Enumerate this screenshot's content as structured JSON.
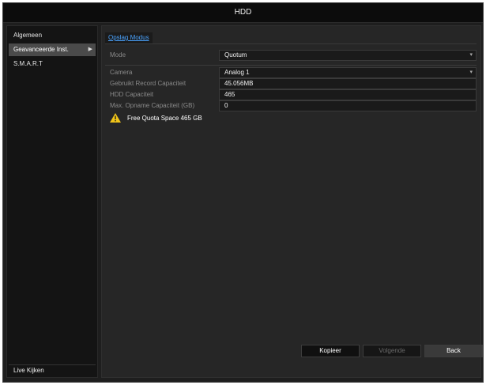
{
  "window": {
    "title": "HDD"
  },
  "sidebar": {
    "items": [
      {
        "label": "Algemeen"
      },
      {
        "label": "Geavanceerde Inst.",
        "active": true
      },
      {
        "label": "S.M.A.R.T"
      }
    ],
    "live_label": "Live Kijken"
  },
  "main": {
    "tab": "Opslag Modus",
    "mode": {
      "label": "Mode",
      "value": "Quotum"
    },
    "fields": [
      {
        "label": "Camera",
        "value": "Analog 1"
      },
      {
        "label": "Gebruikt Record Capaciteit",
        "value": "45.056MB"
      },
      {
        "label": "HDD Capaciteit",
        "value": "465"
      },
      {
        "label": "Max. Opname Capaciteit (GB)",
        "value": "0"
      }
    ],
    "warning_text": "Free Quota Space 465 GB"
  },
  "footer": {
    "buttons": {
      "copy": "Kopieer",
      "next": "Volgende",
      "back": "Back"
    }
  },
  "colors": {
    "link": "#4aa3ff",
    "warning": "#f0c419"
  }
}
